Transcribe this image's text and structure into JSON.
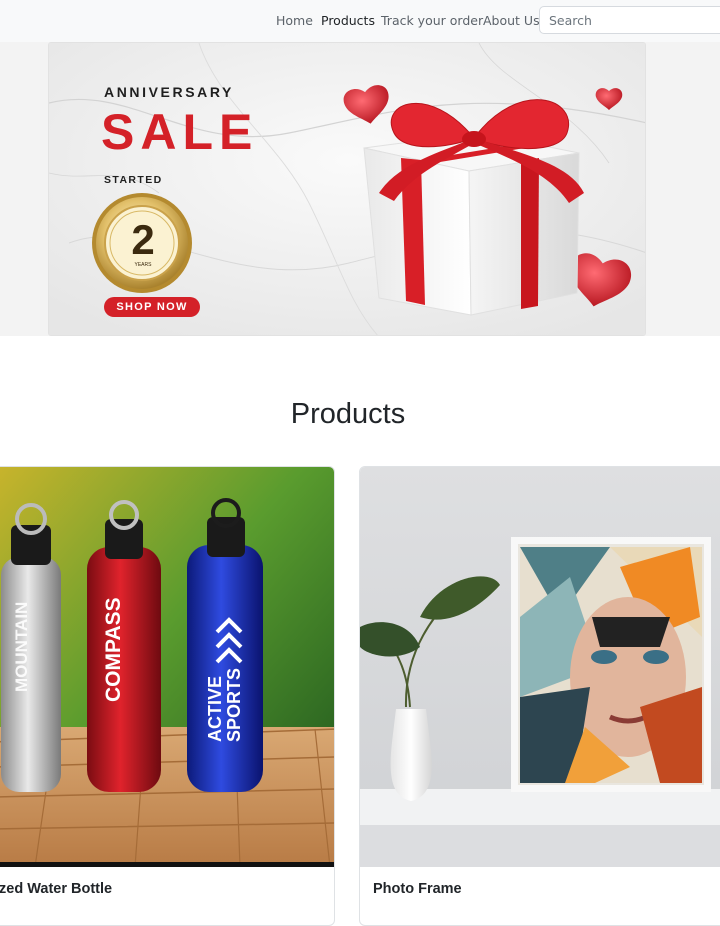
{
  "nav": {
    "links": [
      "Home",
      "Products",
      "Track your order",
      "About Us"
    ],
    "active": "Products",
    "search_placeholder": "Search"
  },
  "banner": {
    "eyebrow": "ANNIVERSARY",
    "headline": "SALE",
    "subtext": "STARTED",
    "badge_number": "2",
    "badge_text": "YEARS",
    "cta": "SHOP NOW"
  },
  "section": {
    "title": "Products"
  },
  "products": [
    {
      "title": "ized Water Bottle"
    },
    {
      "title": "Photo Frame"
    }
  ],
  "colors": {
    "navbar_bg": "#f8f9fa",
    "sale_red": "#d42128",
    "heading_text": "#212529"
  }
}
